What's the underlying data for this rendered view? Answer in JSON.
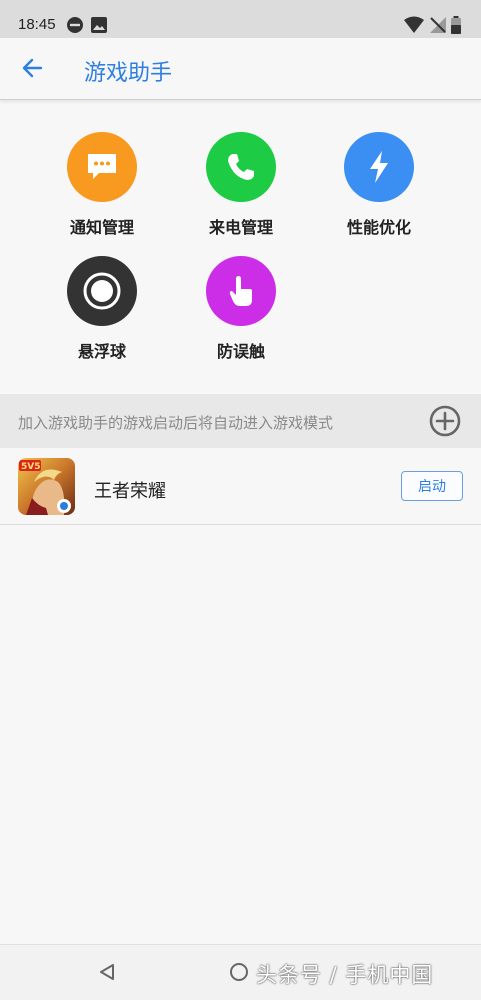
{
  "status_bar": {
    "time": "18:45"
  },
  "app_bar": {
    "title": "游戏助手"
  },
  "tools": [
    {
      "label": "通知管理",
      "icon": "message-dots-icon",
      "color": "#f79a1f"
    },
    {
      "label": "来电管理",
      "icon": "phone-icon",
      "color": "#1dcb45"
    },
    {
      "label": "性能优化",
      "icon": "lightning-icon",
      "color": "#3b8ff2"
    },
    {
      "label": "悬浮球",
      "icon": "floating-ball-icon",
      "color": "#333333"
    },
    {
      "label": "防误触",
      "icon": "touch-hand-icon",
      "color": "#cc2ee8"
    }
  ],
  "hint": {
    "text": "加入游戏助手的游戏启动后将自动进入游戏模式"
  },
  "games": [
    {
      "name": "王者荣耀",
      "launch_label": "启动"
    }
  ],
  "watermark": "头条号 / 手机中国",
  "colors": {
    "accent": "#2e7fe0",
    "background": "#f7f7f7"
  }
}
